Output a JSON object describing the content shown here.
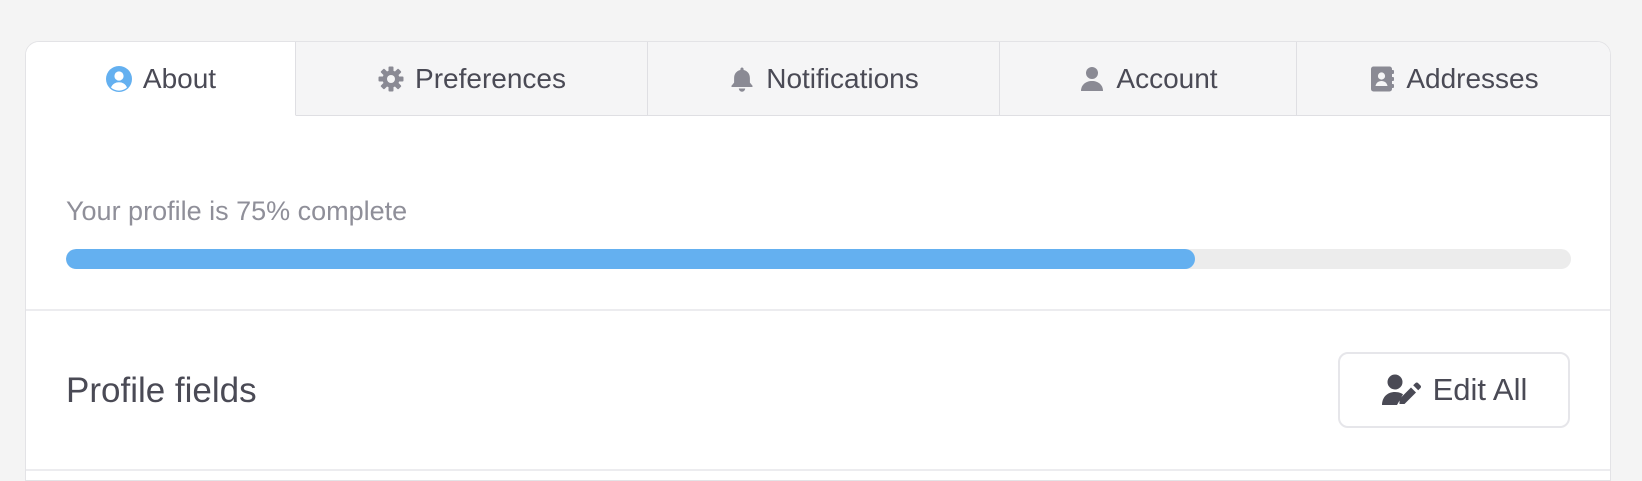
{
  "tabs": [
    {
      "label": "About",
      "icon": "user-circle-icon",
      "active": true
    },
    {
      "label": "Preferences",
      "icon": "gear-icon",
      "active": false
    },
    {
      "label": "Notifications",
      "icon": "bell-icon",
      "active": false
    },
    {
      "label": "Account",
      "icon": "user-icon",
      "active": false
    },
    {
      "label": "Addresses",
      "icon": "address-book-icon",
      "active": false
    }
  ],
  "progress": {
    "label": "Your profile is 75% complete",
    "percent": 75,
    "color": "#64b0f0"
  },
  "profile_fields": {
    "title": "Profile fields",
    "edit_all_label": "Edit All",
    "edit_icon": "user-edit-icon"
  },
  "colors": {
    "accent": "#64b0f0",
    "text": "#4a4a55",
    "muted": "#8f8f99"
  }
}
